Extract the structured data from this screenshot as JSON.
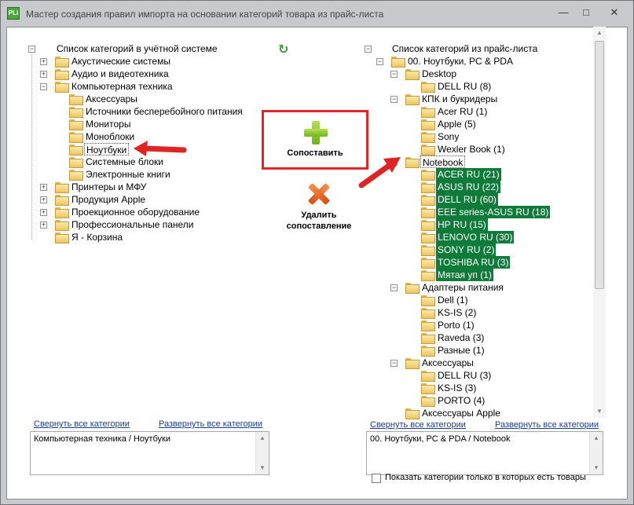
{
  "window": {
    "title": "Мастер создания правил импорта на основании категорий товара из прайс-листа",
    "app_icon_text": "PLi",
    "minimize_icon": "minimize-icon",
    "maximize_icon": "maximize-icon",
    "close_icon": "close-icon"
  },
  "left_panel": {
    "header": "Список категорий в учётной системе",
    "items": [
      {
        "label": "Акустические системы"
      },
      {
        "label": "Аудио и видеотехника"
      },
      {
        "label": "Компьютерная техника"
      },
      {
        "label": "Аксессуары"
      },
      {
        "label": "Источники бесперебойного питания"
      },
      {
        "label": "Мониторы"
      },
      {
        "label": "Моноблоки"
      },
      {
        "label": "Ноутбуки"
      },
      {
        "label": "Системные блоки"
      },
      {
        "label": "Электронные книги"
      },
      {
        "label": "Принтеры и МФУ"
      },
      {
        "label": "Продукция Apple"
      },
      {
        "label": "Проекционное оборудование"
      },
      {
        "label": "Профессиональные панели"
      },
      {
        "label": "Я - Корзина"
      }
    ],
    "collapse_all": "Свернуть все категории",
    "expand_all": "Развернуть все категории",
    "path": "Компьютерная техника / Ноутбуки"
  },
  "center": {
    "match_button": "Сопоставить",
    "delete_button_line1": "Удалить",
    "delete_button_line2": "сопоставление",
    "refresh_icon": "refresh-icon"
  },
  "right_panel": {
    "header": "Список категорий из прайс-листа",
    "items": [
      {
        "label": "00. Ноутбуки, PC & PDA"
      },
      {
        "label": "Desktop"
      },
      {
        "label": "DELL RU (8)"
      },
      {
        "label": "КПК и букридеры"
      },
      {
        "label": "Acer RU (1)"
      },
      {
        "label": "Apple (5)"
      },
      {
        "label": "Sony"
      },
      {
        "label": "Wexler Book (1)"
      },
      {
        "label": "Notebook"
      },
      {
        "label": "ACER RU (21)"
      },
      {
        "label": "ASUS RU (22)"
      },
      {
        "label": "DELL RU (60)"
      },
      {
        "label": "EEE series-ASUS RU (18)"
      },
      {
        "label": "HP RU (15)"
      },
      {
        "label": "LENOVO RU (30)"
      },
      {
        "label": "SONY RU (2)"
      },
      {
        "label": "TOSHIBA RU (3)"
      },
      {
        "label": "Мятая уп (1)"
      },
      {
        "label": "Адаптеры питания"
      },
      {
        "label": "Dell (1)"
      },
      {
        "label": "KS-IS (2)"
      },
      {
        "label": "Porto (1)"
      },
      {
        "label": "Raveda (3)"
      },
      {
        "label": "Разные (1)"
      },
      {
        "label": "Аксессуары"
      },
      {
        "label": "DELL RU (3)"
      },
      {
        "label": "KS-IS (3)"
      },
      {
        "label": "PORTO (4)"
      },
      {
        "label": "Аксессуары Apple"
      }
    ],
    "collapse_all": "Свернуть все категории",
    "expand_all": "Развернуть все категории",
    "path": "00. Ноутбуки, PC & PDA / Notebook",
    "checkbox_label": "Показать категории только в которых есть товары"
  },
  "colors": {
    "highlight": "#0f7b3b",
    "annotation_red": "#e32626",
    "link": "#1a3d9a"
  }
}
